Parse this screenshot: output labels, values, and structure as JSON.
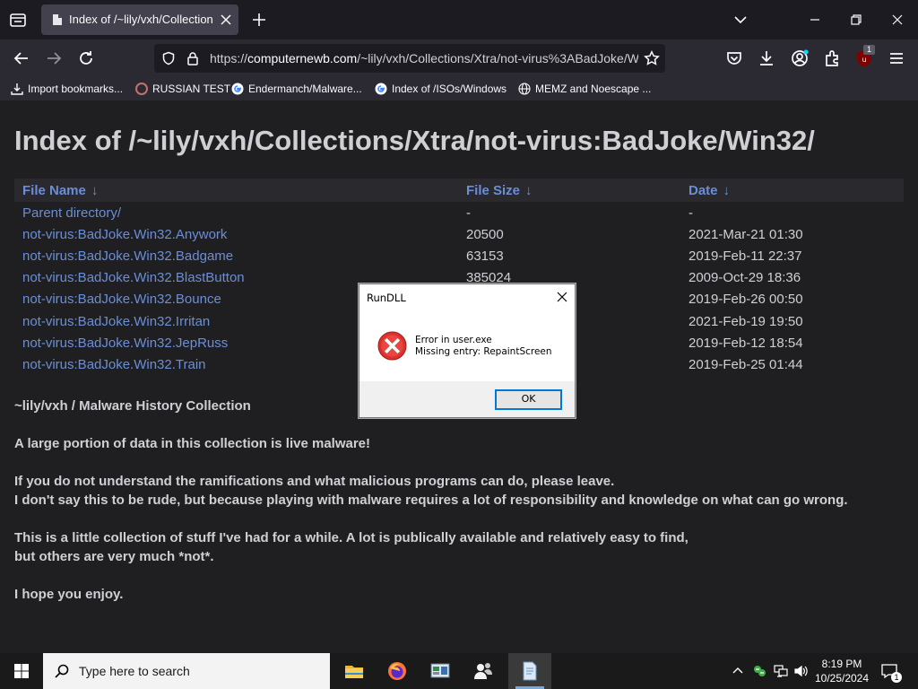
{
  "browser": {
    "tab_title": "Index of /~lily/vxh/Collections/",
    "url_host": "computernewb.com",
    "url_prefix": "https://",
    "url_rest": "/~lily/vxh/Collections/Xtra/not-virus%3ABadJoke/W",
    "extension_badge": "1",
    "bookmarks": [
      {
        "label": "Import bookmarks...",
        "icon": "import-icon"
      },
      {
        "label": "RUSSIAN TEST",
        "icon": "favicon"
      },
      {
        "label": "Endermanch/Malware...",
        "icon": "google-icon"
      },
      {
        "label": "Index of /ISOs/Windows",
        "icon": "google-icon"
      },
      {
        "label": "MEMZ and Noescape ...",
        "icon": "globe-icon"
      }
    ]
  },
  "page": {
    "heading": "Index of /~lily/vxh/Collections/Xtra/not-virus:BadJoke/Win32/",
    "columns": [
      {
        "label": "File Name",
        "sort_arrow": "↓"
      },
      {
        "label": "File Size",
        "sort_arrow": "↓"
      },
      {
        "label": "Date",
        "sort_arrow": "↓"
      }
    ],
    "rows": [
      {
        "name": "Parent directory/",
        "size": "-",
        "date": "-"
      },
      {
        "name": "not-virus:BadJoke.Win32.Anywork",
        "size": "20500",
        "date": "2021-Mar-21 01:30"
      },
      {
        "name": "not-virus:BadJoke.Win32.Badgame",
        "size": "63153",
        "date": "2019-Feb-11 22:37"
      },
      {
        "name": "not-virus:BadJoke.Win32.BlastButton",
        "size": "385024",
        "date": "2009-Oct-29 18:36"
      },
      {
        "name": "not-virus:BadJoke.Win32.Bounce",
        "size": "",
        "date": "2019-Feb-26 00:50"
      },
      {
        "name": "not-virus:BadJoke.Win32.Irritan",
        "size": "",
        "date": "2021-Feb-19 19:50"
      },
      {
        "name": "not-virus:BadJoke.Win32.JepRuss",
        "size": "",
        "date": "2019-Feb-12 18:54"
      },
      {
        "name": "not-virus:BadJoke.Win32.Train",
        "size": "",
        "date": "2019-Feb-25 01:44"
      }
    ],
    "notes": [
      "~lily/vxh / Malware History Collection",
      "A large portion of data in this collection is live malware!",
      "If you do not understand the ramifications and what malicious programs can do, please leave.",
      "I don't say this to be rude, but because playing with malware requires a lot of responsibility and knowledge on what can go wrong.",
      "This is a little collection of stuff I've had for a while. A lot is publically available and relatively easy to find,",
      "but others are very much *not*.",
      "I hope you enjoy."
    ]
  },
  "dialog": {
    "title": "RunDLL",
    "line1": "Error in user.exe",
    "line2": "Missing entry: RepaintScreen",
    "ok_label": "OK"
  },
  "taskbar": {
    "search_placeholder": "Type here to search",
    "time": "8:19 PM",
    "date": "10/25/2024",
    "notification_count": "1",
    "apps": [
      "file-explorer-icon",
      "firefox-icon",
      "app-icon",
      "people-icon",
      "notepad-icon"
    ]
  },
  "colors": {
    "link": "#6b8ed6",
    "text": "#cfcfd4",
    "page_bg": "#1f1f22",
    "error_red": "#d9322f"
  }
}
